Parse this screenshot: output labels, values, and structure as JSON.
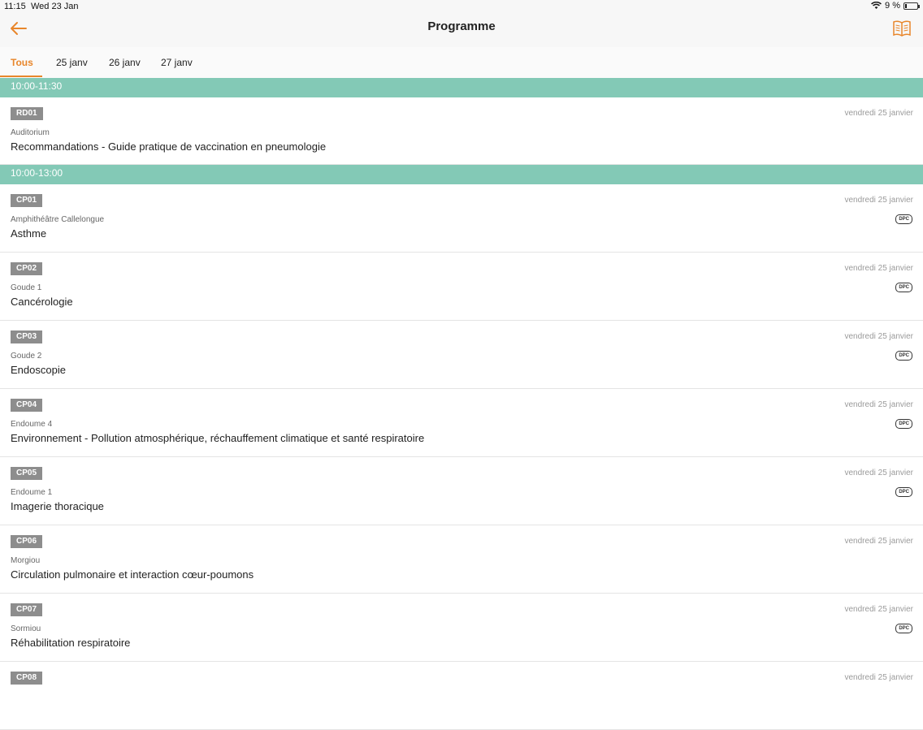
{
  "status_bar": {
    "time": "11:15",
    "date": "Wed 23 Jan",
    "battery": "9 %"
  },
  "header": {
    "title": "Programme",
    "back_icon": "back-arrow-icon",
    "book_icon": "book-icon"
  },
  "colors": {
    "accent": "#e8862b",
    "slot_bar": "#83c9b6",
    "code_badge": "#8d8d8d"
  },
  "tabs": [
    {
      "label": "Tous",
      "active": true
    },
    {
      "label": "25 janv"
    },
    {
      "label": "26 janv"
    },
    {
      "label": "27 janv"
    }
  ],
  "slots": [
    {
      "time": "10:00-11:30",
      "sessions": [
        {
          "code": "RD01",
          "room": "Auditorium",
          "title": "Recommandations - Guide pratique de vaccination en pneumologie",
          "date": "vendredi 25 janvier",
          "dpc": false
        }
      ]
    },
    {
      "time": "10:00-13:00",
      "sessions": [
        {
          "code": "CP01",
          "room": "Amphithéâtre Callelongue",
          "title": "Asthme",
          "date": "vendredi 25 janvier",
          "dpc": true
        },
        {
          "code": "CP02",
          "room": "Goude 1",
          "title": "Cancérologie",
          "date": "vendredi 25 janvier",
          "dpc": true
        },
        {
          "code": "CP03",
          "room": "Goude 2",
          "title": "Endoscopie",
          "date": "vendredi 25 janvier",
          "dpc": true
        },
        {
          "code": "CP04",
          "room": "Endoume 4",
          "title": "Environnement - Pollution atmosphérique, réchauffement climatique et santé respiratoire",
          "date": "vendredi 25 janvier",
          "dpc": true
        },
        {
          "code": "CP05",
          "room": "Endoume 1",
          "title": "Imagerie thoracique",
          "date": "vendredi 25 janvier",
          "dpc": true
        },
        {
          "code": "CP06",
          "room": "Morgiou",
          "title": "Circulation pulmonaire et interaction cœur-poumons",
          "date": "vendredi 25 janvier",
          "dpc": false
        },
        {
          "code": "CP07",
          "room": "Sormiou",
          "title": "Réhabilitation respiratoire",
          "date": "vendredi 25 janvier",
          "dpc": true
        },
        {
          "code": "CP08",
          "room": "",
          "title": "",
          "date": "vendredi 25 janvier",
          "dpc": false
        }
      ]
    }
  ],
  "dpc_label": "DPC"
}
